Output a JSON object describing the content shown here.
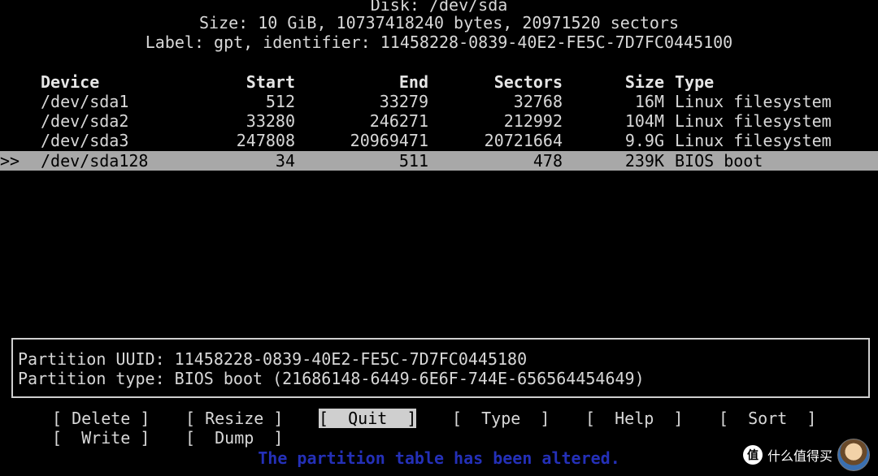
{
  "disk": {
    "title": "Disk: /dev/sda",
    "size_line": "Size: 10 GiB, 10737418240 bytes, 20971520 sectors",
    "label_line": "Label: gpt, identifier: 11458228-0839-40E2-FE5C-7D7FC0445100"
  },
  "table": {
    "headers": {
      "device": "Device",
      "start": "Start",
      "end": "End",
      "sectors": "Sectors",
      "size": "Size",
      "type": "Type"
    },
    "rows": [
      {
        "marker": "",
        "device": "/dev/sda1",
        "start": "512",
        "end": "33279",
        "sectors": "32768",
        "size": "16M",
        "type": "Linux filesystem"
      },
      {
        "marker": "",
        "device": "/dev/sda2",
        "start": "33280",
        "end": "246271",
        "sectors": "212992",
        "size": "104M",
        "type": "Linux filesystem"
      },
      {
        "marker": "",
        "device": "/dev/sda3",
        "start": "247808",
        "end": "20969471",
        "sectors": "20721664",
        "size": "9.9G",
        "type": "Linux filesystem"
      },
      {
        "marker": ">>",
        "device": "/dev/sda128",
        "start": "34",
        "end": "511",
        "sectors": "478",
        "size": "239K",
        "type": "BIOS boot"
      }
    ]
  },
  "info": {
    "uuid_line": "Partition UUID: 11458228-0839-40E2-FE5C-7D7FC0445180",
    "type_line": "Partition type: BIOS boot (21686148-6449-6E6F-744E-656564454649)"
  },
  "menu": {
    "delete": "[ Delete ]",
    "resize": "[ Resize ]",
    "quit": "[  Quit  ]",
    "type": "[  Type  ]",
    "help": "[  Help  ]",
    "sort": "[  Sort  ]",
    "write": "[  Write ]",
    "dump": "[  Dump  ]"
  },
  "status": "The partition table has been altered.",
  "watermark": {
    "logo": "值",
    "text": "什么值得买"
  },
  "colors": {
    "background": "#000000",
    "selection": "#a8a8a8",
    "status_text": "#2430b8"
  }
}
